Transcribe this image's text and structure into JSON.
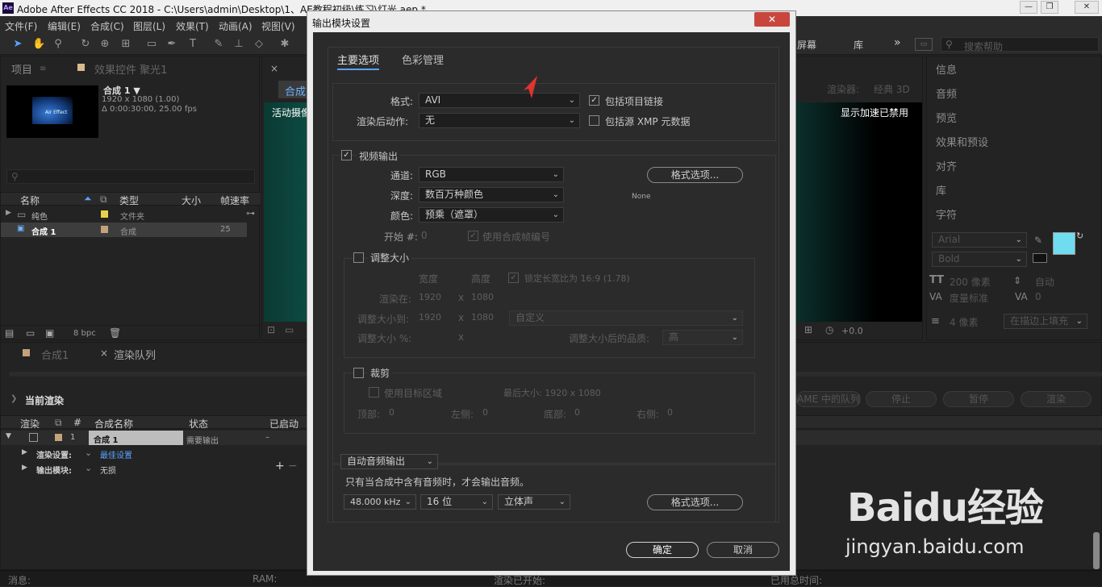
{
  "window": {
    "title": "Adobe After Effects CC 2018 - C:\\Users\\admin\\Desktop\\1、AE教程初级\\练习\\灯光.aep *",
    "logo": "Ae"
  },
  "menu": [
    "文件(F)",
    "编辑(E)",
    "合成(C)",
    "图层(L)",
    "效果(T)",
    "动画(A)",
    "视图(V)"
  ],
  "workspace_right": {
    "screen": "屏幕",
    "lib": "库",
    "search_placeholder": "搜索帮助",
    "more": "»"
  },
  "project_panel": {
    "tab_project": "项目",
    "tab_effects": "效果控件 聚光1",
    "comp_name": "合成 1 ▼",
    "comp_res": "1920 x 1080 (1.00)",
    "comp_dur": "Δ 0:00:30:00, 25.00 fps",
    "thumb_text": "Air Effect",
    "columns": {
      "name": "名称",
      "type": "类型",
      "size": "大小",
      "fps": "帧速率"
    },
    "rows": [
      {
        "name": "纯色",
        "type": "文件夹",
        "fps": ""
      },
      {
        "name": "合成 1",
        "type": "合成",
        "fps": "25"
      }
    ],
    "bpc": "8 bpc"
  },
  "comp_viewer": {
    "tab": "合成",
    "label_camera": "活动摄像",
    "renderer": "渲染器:",
    "renderer_value": "经典 3D",
    "accel": "显示加速已禁用",
    "offset": "+0.0"
  },
  "right_panels": [
    "信息",
    "音频",
    "预览",
    "效果和预设",
    "对齐",
    "库",
    "字符"
  ],
  "character": {
    "font": "Arial",
    "style": "Bold",
    "size": "200 像素",
    "leading": "自动",
    "kerning": "度量标准",
    "tracking": "0",
    "stroke": "4 像素",
    "stroke_mode": "在描边上填充",
    "fill_color": "#6fdcf0"
  },
  "render_queue": {
    "tab_comp": "合成1",
    "tab_queue": "渲染队列",
    "current_render": "当前渲染",
    "buttons": {
      "queue_ame": "AME 中的队列",
      "stop": "停止",
      "pause": "暂停",
      "render": "渲染"
    },
    "columns": {
      "render": "渲染",
      "num": "#",
      "comp": "合成名称",
      "status": "状态",
      "started": "已启动"
    },
    "item": {
      "num": "1",
      "comp": "合成 1",
      "status": "需要输出",
      "started": "–"
    },
    "render_settings_label": "渲染设置:",
    "render_settings_value": "最佳设置",
    "output_module_label": "输出模块:",
    "output_module_value": "无损"
  },
  "status_bar": {
    "msg": "消息:",
    "ram": "RAM:",
    "render_started": "渲染已开始:",
    "elapsed": "已用总时间:"
  },
  "dialog": {
    "title": "输出模块设置",
    "close": "✕",
    "tabs": {
      "main": "主要选项",
      "color": "色彩管理"
    },
    "format_label": "格式:",
    "format_value": "AVI",
    "post_render_label": "渲染后动作:",
    "post_render_value": "无",
    "include_link": "包括项目链接",
    "include_xmp": "包括源 XMP 元数据",
    "video_output": "视频输出",
    "channel_label": "通道:",
    "channel_value": "RGB",
    "depth_label": "深度:",
    "depth_value": "数百万种颜色",
    "color_label": "颜色:",
    "color_value": "预乘（遮罩）",
    "start_label": "开始 #:",
    "start_value": "0",
    "use_comp_frame": "使用合成帧编号",
    "format_options": "格式选项...",
    "codec": "None",
    "resize": "调整大小",
    "width_h": "宽度",
    "height_h": "高度",
    "lock_aspect": "锁定长宽比为 16:9 (1.78)",
    "render_at": "渲染在:",
    "render_w": "1920",
    "render_h": "1080",
    "x": "x",
    "resize_to": "调整大小到:",
    "resize_w": "1920",
    "resize_h": "1080",
    "resize_preset": "自定义",
    "resize_pct": "调整大小 %:",
    "resize_quality": "调整大小后的品质:",
    "quality_value": "高",
    "crop": "裁剪",
    "use_roi": "使用目标区域",
    "final_size": "最后大小: 1920 x 1080",
    "top": "顶部:",
    "top_v": "0",
    "left": "左侧:",
    "left_v": "0",
    "bottom": "底部:",
    "bottom_v": "0",
    "right": "右侧:",
    "right_v": "0",
    "audio_mode": "自动音频输出",
    "audio_note": "只有当合成中含有音频时，才会输出音频。",
    "audio_rate": "48.000 kHz",
    "audio_bits": "16 位",
    "audio_ch": "立体声",
    "audio_format_options": "格式选项...",
    "ok": "确定",
    "cancel": "取消"
  },
  "watermark": {
    "brand": "Baidu经验",
    "url": "jingyan.baidu.com"
  }
}
